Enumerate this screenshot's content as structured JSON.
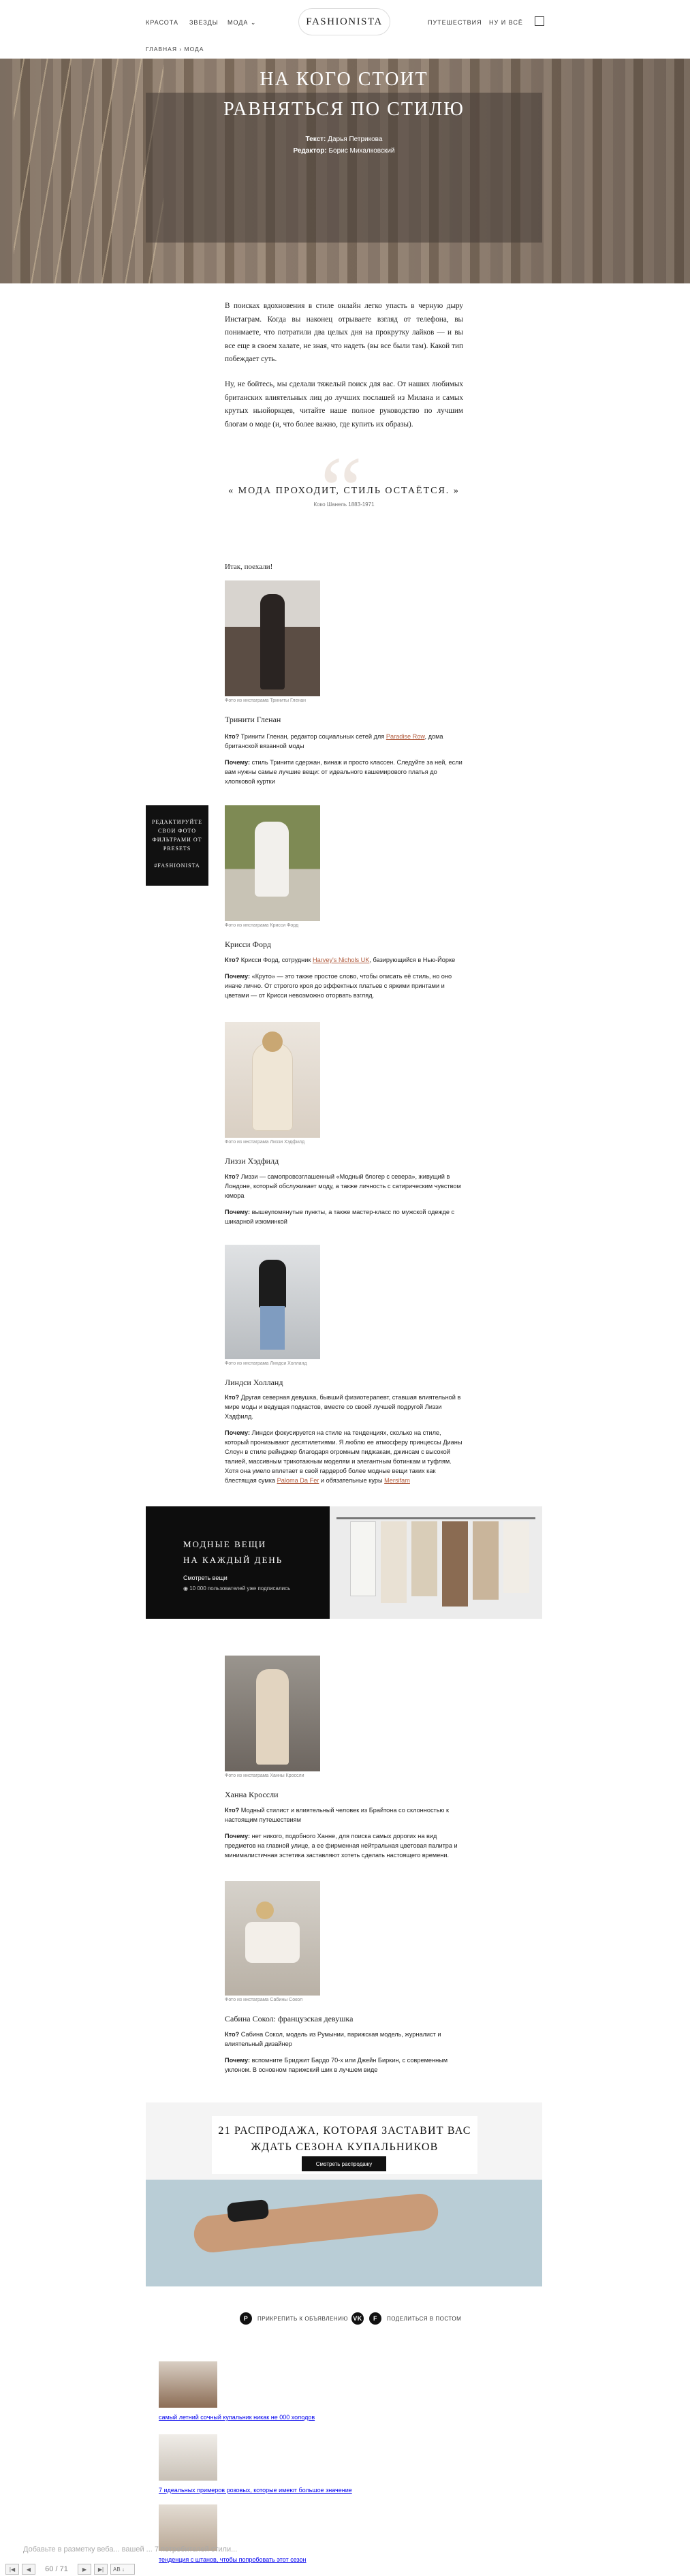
{
  "header": {
    "nav_left": [
      "КРАСОТА",
      "ЗВЕЗДЫ",
      "МОДА ⌄"
    ],
    "nav_right": [
      "ПУТЕШЕСТВИЯ",
      "НУ И ВСЁ"
    ],
    "logo": "FASHIONISTA",
    "breadcrumb": "ГЛАВНАЯ  ›  МОДА"
  },
  "hero": {
    "title_line1": "НА КОГО СТОИТ",
    "title_line2": "РАВНЯТЬСЯ ПО СТИЛЮ",
    "text_label": "Текст:",
    "text_value": "Дарья Петрикова",
    "editor_label": "Редактор:",
    "editor_value": "Борис Михалковский"
  },
  "article": {
    "para1": "В поисках вдохновения в стиле онлайн легко упасть в черную дыру Инстаграм. Когда вы наконец отрываете взгляд от телефона, вы понимаете, что потратили два целых дня на прокрутку лайков — и вы все еще в своем халате, не зная, что надеть (вы все были там). Какой тип побеждает суть.",
    "para2": "Ну, не бойтесь, мы сделали тяжелый поиск для вас. От наших любимых британских влиятельных лиц до лучших послашей из Милана и самых крутых ньюйоркцев, читайте наше полное руководство по лучшим блогам о моде (и, что более важно, где купить их образы).",
    "quote": "МОДА ПРОХОДИТ, СТИЛЬ ОСТАЁТСЯ.",
    "quote_author": "Коко Шанель 1883-1971",
    "intro": "Итак, поехали!"
  },
  "profiles": [
    {
      "caption": "Фото из инстаграма Триниты Гленан",
      "name": "Тринити Гленан",
      "who_label": "Кто?",
      "who": " Тринити Гленан, редактор социальных сетей для ",
      "who_link": "Paradise Row",
      "who_tail": ", дома британской вязанной моды",
      "why_label": "Почему:",
      "why": " стиль Тринити сдержан, винаж и просто классен. Следуйте за ней, если вам нужны самые лучшие вещи: от идеального кашемирового платья до хлопковой куртки"
    },
    {
      "caption": "Фото из инстаграма Крисси Форд",
      "name": "Крисси Форд",
      "who_label": "Кто?",
      "who": " Крисси Форд, сотрудник ",
      "who_link": "Harvey's Nichols UK",
      "who_tail": ", базирующийся в Нью-Йорке",
      "why_label": "Почему:",
      "why": " «Круто» — это также простое слово, чтобы описать её стиль, но оно иначе лично. От строгого кроя до эффектных платьев с яркими принтами и цветами — от Крисси невозможно оторвать взгляд."
    },
    {
      "caption": "Фото из инстаграма Лиззи Хэдфилд",
      "name": "Лиззи Хэдфилд",
      "who_label": "Кто?",
      "who": " Лиззи — самопровозглашенный «Модный блогер с севера», живущий в Лондоне, который обслуживает моду, а также личность с сатирическим чувством юмора",
      "who_link": "",
      "who_tail": "",
      "why_label": "Почему:",
      "why": " вышеупомянутые пункты, а также мастер-класс по мужской одежде с шикарной изюминкой"
    },
    {
      "caption": "Фото из инстаграма Линдси Холланд",
      "name": "Линдси Холланд",
      "who_label": "Кто?",
      "who": " Другая северная девушка, бывший физиотерапевт, ставшая влиятельной в мире моды и ведущая подкастов, вместе со своей лучшей подругой Лиззи Хэдфилд.",
      "who_link": "",
      "who_tail": "",
      "why_label": "Почему:",
      "why": " Линдси фокусируется на стиле на тенденциях, сколько на стиле, который пронизывают десятилетиями. Я люблю ее атмосферу принцессы Дианы Слоун в стиле рейнджер благодаря огромным пиджакам, джинсам с высокой талией, массивным трикотажным моделям и элегантным ботинкам и туфлям. Хотя она умело вплетает в свой гардероб более модные вещи таких как блестящая сумка ",
      "why_link": "Paloma Da Fer",
      "why_tail": " и обязательные куры ",
      "why_link2": "Mersifam"
    },
    {
      "caption": "Фото из инстаграма Ханны Кроссли",
      "name": "Ханна Кроссли",
      "who_label": "Кто?",
      "who": " Модный стилист и влиятельный человек из Брайтона со склонностью к настоящим путешествиям",
      "who_link": "",
      "who_tail": "",
      "why_label": "Почему:",
      "why": " нет никого, подобного Ханне, для поиска самых дорогих на вид предметов на главной улице, а ее фирменная нейтральная цветовая палитра и минималистичная эстетика заставляют хотеть сделать настоящего времени."
    },
    {
      "caption": "Фото из инстаграма Сабины Сокол",
      "name": "Сабина Сокол: французская девушка",
      "who_label": "Кто?",
      "who": " Сабина Сокол, модель из Румынии, парижская модель, журналист и влиятельный дизайнер",
      "who_link": "",
      "who_tail": "",
      "why_label": "Почему:",
      "why": " вспомните Бриджит Бардо 70-х или Джейн Биркин, с современным уклоном. В основном парижский шик в лучшем виде"
    }
  ],
  "promo": {
    "line1": "РЕДАКТИРУЙТЕ",
    "line2": "СВОИ ФОТО",
    "line3": "ФИЛЬТРАМИ ОТ",
    "line4": "PRESETS",
    "tag": "#FASHIONISTA"
  },
  "banner": {
    "title_line1": "МОДНЫЕ ВЕЩИ",
    "title_line2": "НА КАЖДЫЙ ДЕНЬ",
    "link": "Смотреть вещи",
    "subs": "10 000 пользователей уже подписались"
  },
  "sale": {
    "title_line1": "21 РАСПРОДАЖА, КОТОРАЯ ЗАСТАВИТ ВАС",
    "title_line2": "ЖДАТЬ СЕЗОНА КУПАЛЬНИКОВ",
    "button": "Смотреть распродажу"
  },
  "share": {
    "pin": "ПРИКРЕПИТЬ К ОБЪЯВЛЕНИЮ",
    "share": "ПОДЕЛИТЬСЯ В ПОСТОМ",
    "pin_icon": "P",
    "vk_icon": "vk",
    "fb_icon": "f"
  },
  "related": [
    "самый летний сочный купальник никак не 000 холодов",
    "7 идеальных примеров розовых, которые имеют большое значение",
    "тенденция с штанов, чтобы попробовать этот сезон"
  ],
  "toolbar": {
    "note": "Добавьте в разметку веба... вашей ... 7 потребителей стили...",
    "page": "60 / 71",
    "field": "AB ↓"
  },
  "colors": {
    "accent_link": "#b05a3c",
    "banner_bg": "#0d0d0d",
    "promo_bg": "#111111"
  }
}
